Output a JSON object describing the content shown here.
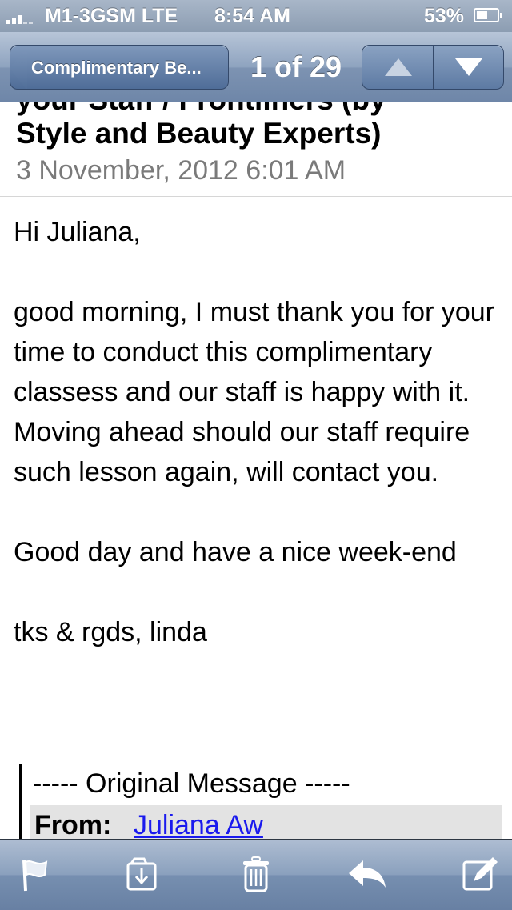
{
  "status_bar": {
    "carrier": "M1-3GSM  LTE",
    "time": "8:54 AM",
    "battery": "53%",
    "battery_level": 0.53
  },
  "nav": {
    "back_label": "Complimentary Be...",
    "position": "1 of 29",
    "up_icon": "chevron-up-icon",
    "down_icon": "chevron-down-icon"
  },
  "message": {
    "subject_partial": "your Staff / Frontliners (by",
    "subject_line": "Style and Beauty Experts)",
    "date": "3 November, 2012 6:01 AM",
    "body": [
      "Hi Juliana,",
      "",
      "good morning, I must thank you for your time to conduct this complimentary classess and our staff is happy with it.",
      "Moving ahead should our staff require such lesson again, will contact you.",
      "",
      "Good day and have a nice week-end",
      "",
      "tks & rgds, linda"
    ],
    "original_message_label": "----- Original Message -----",
    "from_label": "From:",
    "from_name": "Juliana Aw"
  },
  "toolbar": {
    "icons": [
      "flag-icon",
      "move-to-folder-icon",
      "trash-icon",
      "reply-icon",
      "compose-icon"
    ]
  },
  "colors": {
    "link": "#1a1aee",
    "date_gray": "#7a7a7a",
    "bar_blue": "#6e86a8"
  }
}
